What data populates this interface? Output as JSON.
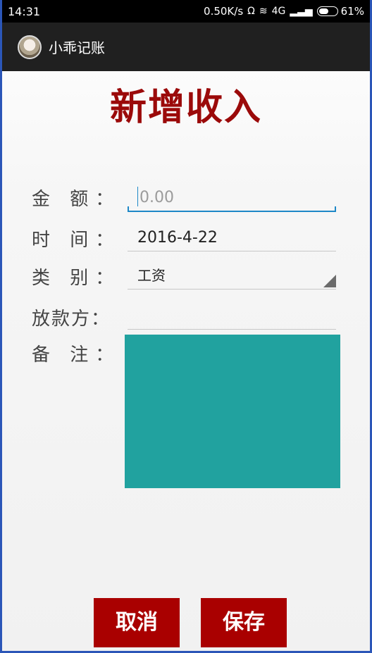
{
  "status_bar": {
    "time": "14:31",
    "net_speed": "0.50K/s",
    "icons": [
      "headset-icon",
      "wifi-icon",
      "4g-icon",
      "signal-icon"
    ],
    "battery_label": "61%",
    "battery_level": 0.61
  },
  "app_bar": {
    "title": "小乖记账",
    "avatar_icon": "user-avatar"
  },
  "page": {
    "title": "新增收入",
    "title_color": "#9b0a0a"
  },
  "form": {
    "amount": {
      "label": "金 额：",
      "placeholder": "0.00",
      "value": ""
    },
    "time": {
      "label": "时 间：",
      "value": "2016-4-22"
    },
    "category": {
      "label": "类 别：",
      "selected": "工资"
    },
    "payer": {
      "label": "放款方：",
      "value": ""
    },
    "notes": {
      "label": "备 注：",
      "value": ""
    }
  },
  "buttons": {
    "cancel": "取消",
    "save": "保存",
    "accent": "#a90000"
  }
}
